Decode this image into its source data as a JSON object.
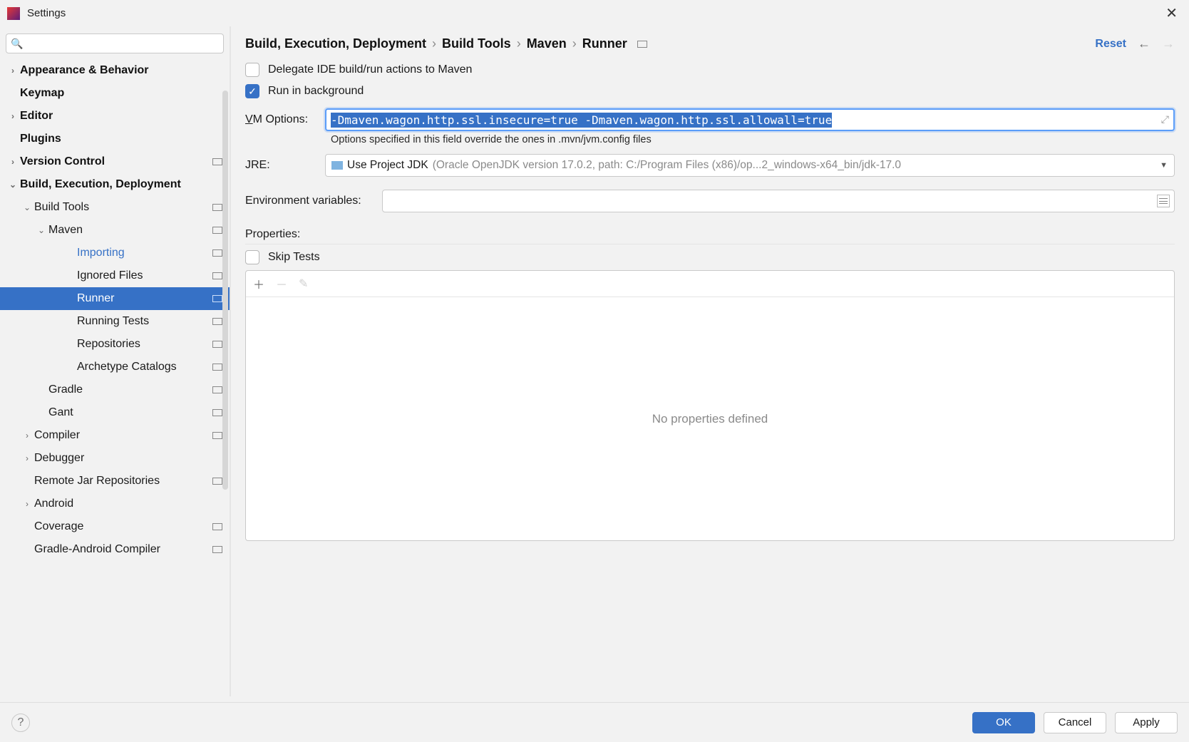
{
  "window": {
    "title": "Settings"
  },
  "search": {
    "placeholder": ""
  },
  "sidebar": {
    "items": [
      {
        "label": "Appearance & Behavior",
        "bold": true,
        "chev": ">",
        "level": 0,
        "badge": false
      },
      {
        "label": "Keymap",
        "bold": true,
        "chev": "",
        "level": 0,
        "badge": false
      },
      {
        "label": "Editor",
        "bold": true,
        "chev": ">",
        "level": 0,
        "badge": false
      },
      {
        "label": "Plugins",
        "bold": true,
        "chev": "",
        "level": 0,
        "badge": false
      },
      {
        "label": "Version Control",
        "bold": true,
        "chev": ">",
        "level": 0,
        "badge": true
      },
      {
        "label": "Build, Execution, Deployment",
        "bold": true,
        "chev": "v",
        "level": 0,
        "badge": false
      },
      {
        "label": "Build Tools",
        "bold": false,
        "chev": "v",
        "level": 1,
        "badge": true
      },
      {
        "label": "Maven",
        "bold": false,
        "chev": "v",
        "level": 2,
        "badge": true
      },
      {
        "label": "Importing",
        "bold": false,
        "chev": "",
        "level": 3,
        "badge": true,
        "link": true
      },
      {
        "label": "Ignored Files",
        "bold": false,
        "chev": "",
        "level": 3,
        "badge": true
      },
      {
        "label": "Runner",
        "bold": false,
        "chev": "",
        "level": 3,
        "badge": true,
        "selected": true
      },
      {
        "label": "Running Tests",
        "bold": false,
        "chev": "",
        "level": 3,
        "badge": true
      },
      {
        "label": "Repositories",
        "bold": false,
        "chev": "",
        "level": 3,
        "badge": true
      },
      {
        "label": "Archetype Catalogs",
        "bold": false,
        "chev": "",
        "level": 3,
        "badge": true
      },
      {
        "label": "Gradle",
        "bold": false,
        "chev": "",
        "level": 2,
        "badge": true
      },
      {
        "label": "Gant",
        "bold": false,
        "chev": "",
        "level": 2,
        "badge": true
      },
      {
        "label": "Compiler",
        "bold": false,
        "chev": ">",
        "level": 1,
        "badge": true
      },
      {
        "label": "Debugger",
        "bold": false,
        "chev": ">",
        "level": 1,
        "badge": false
      },
      {
        "label": "Remote Jar Repositories",
        "bold": false,
        "chev": "",
        "level": 1,
        "badge": true
      },
      {
        "label": "Android",
        "bold": false,
        "chev": ">",
        "level": 1,
        "badge": false
      },
      {
        "label": "Coverage",
        "bold": false,
        "chev": "",
        "level": 1,
        "badge": true
      },
      {
        "label": "Gradle-Android Compiler",
        "bold": false,
        "chev": "",
        "level": 1,
        "badge": true
      }
    ]
  },
  "breadcrumb": {
    "parts": [
      "Build, Execution, Deployment",
      "Build Tools",
      "Maven",
      "Runner"
    ],
    "sep": "›"
  },
  "actions": {
    "reset": "Reset"
  },
  "form": {
    "delegate": {
      "label": "Delegate IDE build/run actions to Maven",
      "checked": false
    },
    "run_bg": {
      "label": "Run in background",
      "checked": true
    },
    "vm": {
      "label_pre": "V",
      "label_post": "M Options:",
      "value": "-Dmaven.wagon.http.ssl.insecure=true -Dmaven.wagon.http.ssl.allowall=true",
      "help": "Options specified in this field override the ones in .mvn/jvm.config files"
    },
    "jre": {
      "label_pre": "J",
      "label_post": "RE:",
      "main": "Use Project JDK",
      "detail": "(Oracle OpenJDK version 17.0.2, path: C:/Program Files (x86)/op...2_windows-x64_bin/jdk-17.0"
    },
    "env": {
      "label_pre": "E",
      "label_post": "nvironment variables:",
      "value": ""
    },
    "properties": {
      "label": "Properties:",
      "skip_tests": "Skip Tests",
      "empty": "No properties defined"
    }
  },
  "footer": {
    "ok": "OK",
    "cancel": "Cancel",
    "apply": "Apply"
  }
}
